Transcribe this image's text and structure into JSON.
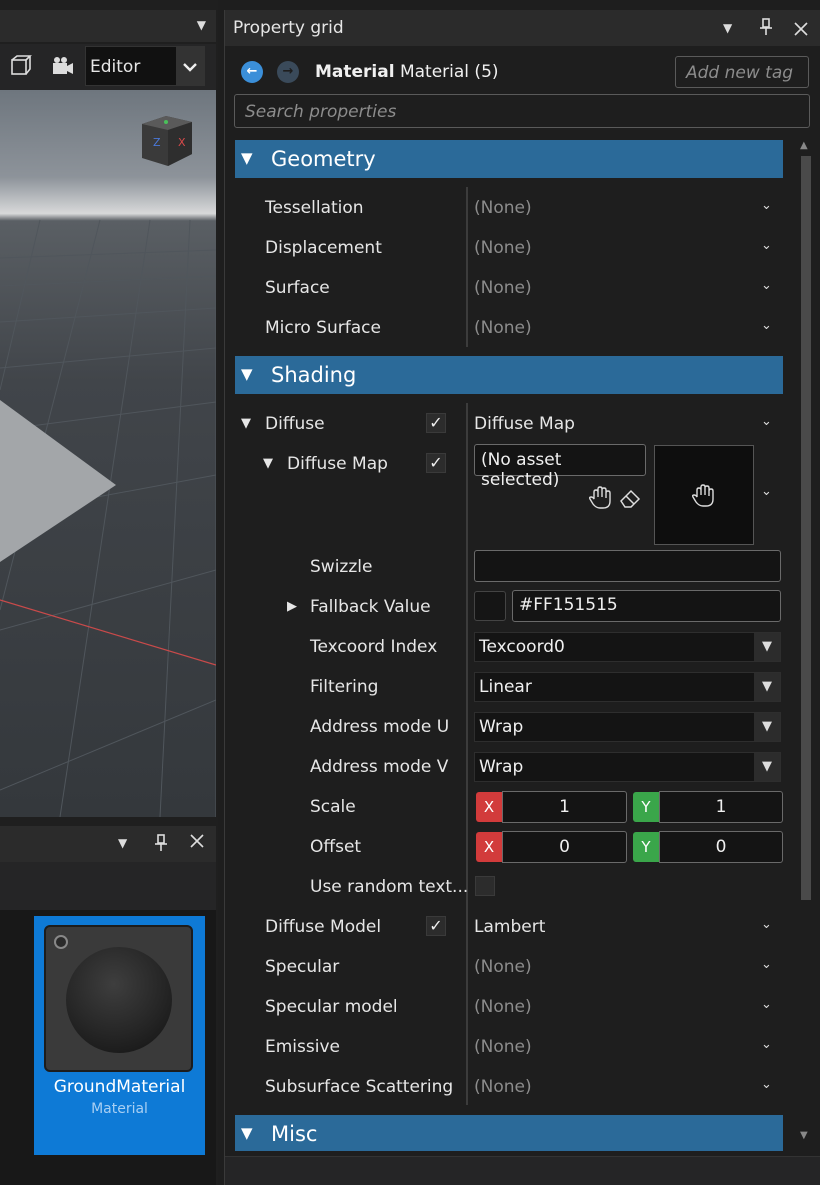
{
  "left": {
    "viewport_mode": "Editor",
    "gizmo": {
      "z_label": "Z",
      "x_label": "X"
    },
    "asset": {
      "name": "GroundMaterial",
      "type": "Material"
    }
  },
  "property_grid": {
    "panel_title": "Property grid",
    "object": {
      "bold": "Material",
      "rest": "Material (5)"
    },
    "add_tag_placeholder": "Add new tag",
    "search_placeholder": "Search properties",
    "sections": {
      "geometry": "Geometry",
      "shading": "Shading",
      "misc": "Misc"
    },
    "geometry_rows": [
      {
        "label": "Tessellation",
        "value": "(None)"
      },
      {
        "label": "Displacement",
        "value": "(None)"
      },
      {
        "label": "Surface",
        "value": "(None)"
      },
      {
        "label": "Micro Surface",
        "value": "(None)"
      }
    ],
    "diffuse": {
      "label": "Diffuse",
      "value": "Diffuse Map",
      "checked": true,
      "map": {
        "label": "Diffuse Map",
        "checked": true,
        "asset_value": "(No asset selected)"
      }
    },
    "swizzle": {
      "label": "Swizzle",
      "value": ""
    },
    "fallback": {
      "label": "Fallback Value",
      "value": "#FF151515",
      "color": "#151515"
    },
    "texcoord": {
      "label": "Texcoord Index",
      "value": "Texcoord0"
    },
    "filtering": {
      "label": "Filtering",
      "value": "Linear"
    },
    "address_u": {
      "label": "Address mode U",
      "value": "Wrap"
    },
    "address_v": {
      "label": "Address mode V",
      "value": "Wrap"
    },
    "scale": {
      "label": "Scale",
      "x_axis": "X",
      "x": "1",
      "y_axis": "Y",
      "y": "1"
    },
    "offset": {
      "label": "Offset",
      "x_axis": "X",
      "x": "0",
      "y_axis": "Y",
      "y": "0"
    },
    "random_tex": {
      "label": "Use random text...",
      "checked": false
    },
    "shading_rows": [
      {
        "label": "Diffuse Model",
        "value": "Lambert",
        "checked": true
      },
      {
        "label": "Specular",
        "value": "(None)"
      },
      {
        "label": "Specular model",
        "value": "(None)"
      },
      {
        "label": "Emissive",
        "value": "(None)"
      },
      {
        "label": "Subsurface Scattering",
        "value": "(None)"
      }
    ]
  },
  "colors": {
    "section_header": "#2b6a99",
    "asset_selected": "#0e7ad6",
    "axis_x": "#d23b3b",
    "axis_y": "#3aa64a"
  }
}
